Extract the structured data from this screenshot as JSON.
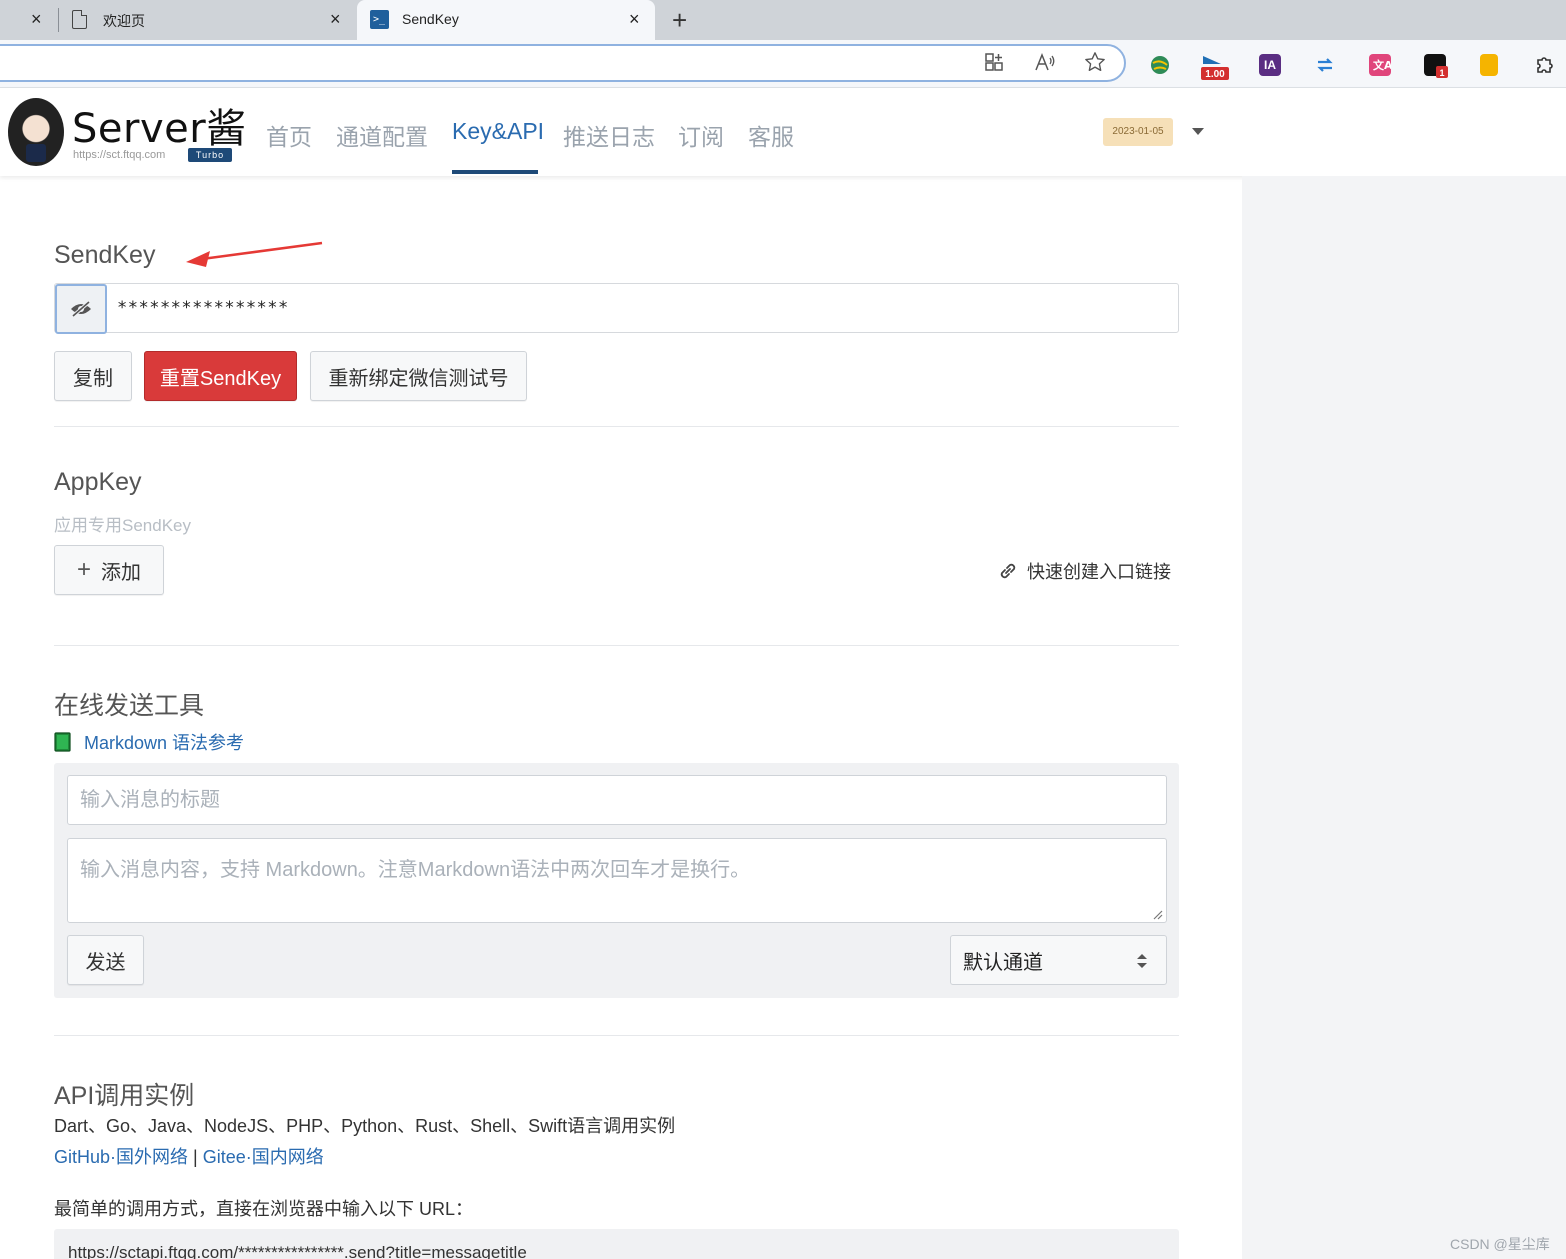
{
  "browser": {
    "tabs": [
      {
        "title": "欢迎页",
        "active": false
      },
      {
        "title": "SendKey",
        "active": true
      }
    ],
    "new_tab_label": "+",
    "close_label": "×",
    "terminal_glyph": ">_",
    "extensions": [
      {
        "name": "globe-extension-icon",
        "color": "#2e8b57"
      },
      {
        "name": "speed-extension-icon",
        "color": "#1f6fb5",
        "badge": "1.00"
      },
      {
        "name": "ia-extension-icon",
        "color": "#5a2d82",
        "text": "IA"
      },
      {
        "name": "sync-extension-icon",
        "color": "#2a7fd4"
      },
      {
        "name": "translate-extension-icon",
        "color": "#e0457b"
      },
      {
        "name": "notify-extension-icon",
        "color": "#111111",
        "badge": "1"
      },
      {
        "name": "note-extension-icon",
        "color": "#f5b400"
      },
      {
        "name": "puzzle-extension-icon",
        "color": "#333333"
      }
    ]
  },
  "site": {
    "brand": "Server酱",
    "url": "https://sct.ftqq.com",
    "edition": "Turbo",
    "nav": [
      "首页",
      "通道配置",
      "Key&API",
      "推送日志",
      "订阅",
      "客服"
    ],
    "active_nav": "Key&API",
    "date_badge": "2023-01-05",
    "accent": "#1e4a78"
  },
  "sendkey": {
    "title": "SendKey",
    "masked_value": "****************",
    "copy_label": "复制",
    "reset_label": "重置SendKey",
    "rebind_label": "重新绑定微信测试号"
  },
  "appkey": {
    "title": "AppKey",
    "subtitle": "应用专用SendKey",
    "add_label": "添加",
    "quick_link_label": "快速创建入口链接"
  },
  "online_tool": {
    "title": "在线发送工具",
    "markdown_link": "Markdown 语法参考",
    "title_placeholder": "输入消息的标题",
    "content_placeholder": "输入消息内容，支持 Markdown。注意Markdown语法中两次回车才是换行。",
    "send_label": "发送",
    "channel_selected": "默认通道"
  },
  "api": {
    "title": "API调用实例",
    "languages_text": "Dart、Go、Java、NodeJS、PHP、Python、Rust、Shell、Swift语言调用实例",
    "github_link": "GitHub·国外网络",
    "separator": "|",
    "gitee_link": "Gitee·国内网络",
    "simple_usage": "最简单的调用方式，直接在浏览器中输入以下 URL：",
    "example_url": "https://sctapi.ftqq.com/****************.send?title=messagetitle"
  },
  "watermark": "CSDN @星尘库",
  "colors": {
    "danger": "#d93a3a",
    "link": "#2a6bb0",
    "annotation_arrow": "#e53935"
  }
}
